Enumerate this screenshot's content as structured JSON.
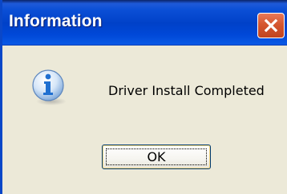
{
  "dialog": {
    "title": "Information",
    "message": "Driver Install Completed",
    "ok_label": "OK",
    "icon": "information-icon",
    "close_icon": "close-icon"
  },
  "colors": {
    "titlebar": "#0044cc",
    "close_button": "#d5562f",
    "dialog_background": "#ece9d8",
    "icon_blue": "#1f6fd0"
  }
}
